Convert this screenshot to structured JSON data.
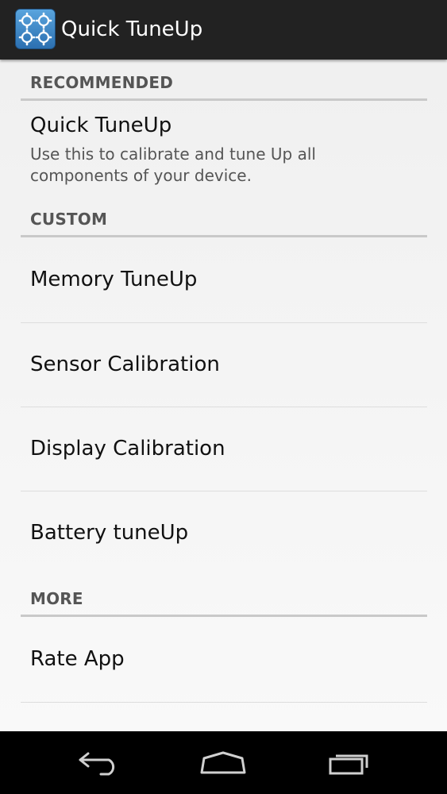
{
  "app": {
    "title": "Quick TuneUp",
    "icon": "gears-icon",
    "accent_color": "#3c87c6"
  },
  "sections": [
    {
      "header": "RECOMMENDED",
      "items": [
        {
          "title": "Quick TuneUp",
          "summary": "Use this to calibrate and tune Up all components of your device."
        }
      ]
    },
    {
      "header": "CUSTOM",
      "items": [
        {
          "title": "Memory TuneUp"
        },
        {
          "title": "Sensor Calibration"
        },
        {
          "title": "Display Calibration"
        },
        {
          "title": "Battery tuneUp"
        }
      ]
    },
    {
      "header": "MORE",
      "items": [
        {
          "title": "Rate App"
        }
      ]
    }
  ],
  "nav_bar": {
    "buttons": [
      "back-icon",
      "home-icon",
      "recent-apps-icon"
    ]
  }
}
